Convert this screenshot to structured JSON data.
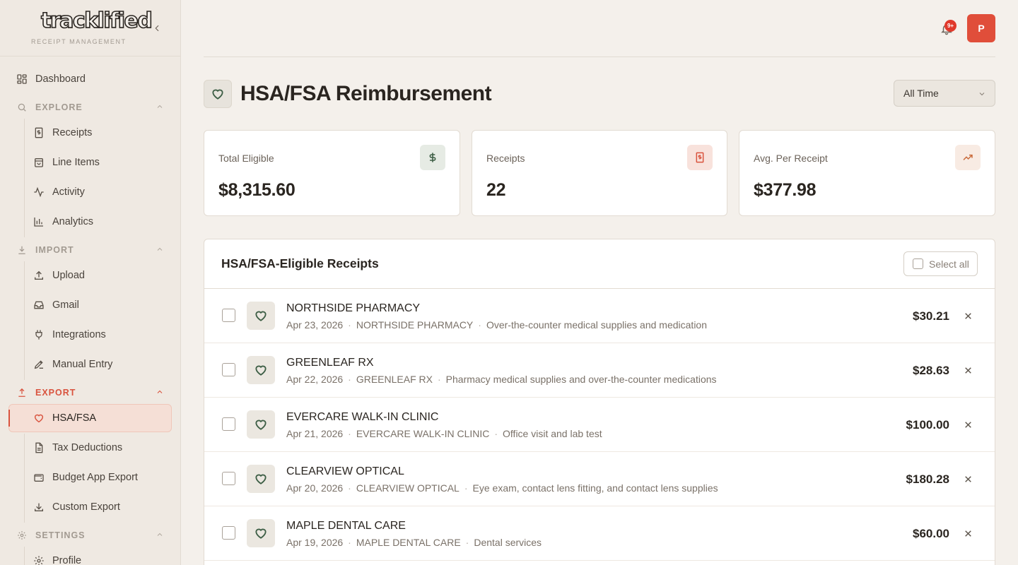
{
  "brand": {
    "logo": "tracklified",
    "tagline": "RECEIPT MANAGEMENT"
  },
  "nav": {
    "dashboard": "Dashboard",
    "explore": {
      "label": "EXPLORE",
      "items": [
        "Receipts",
        "Line Items",
        "Activity",
        "Analytics"
      ]
    },
    "import": {
      "label": "IMPORT",
      "items": [
        "Upload",
        "Gmail",
        "Integrations",
        "Manual Entry"
      ]
    },
    "export": {
      "label": "EXPORT",
      "items": [
        "HSA/FSA",
        "Tax Deductions",
        "Budget App Export",
        "Custom Export"
      ]
    },
    "settings": {
      "label": "SETTINGS",
      "items": [
        "Profile"
      ]
    },
    "active_item": "HSA/FSA"
  },
  "topbar": {
    "notification_badge": "9+",
    "avatar_initial": "P"
  },
  "header": {
    "title": "HSA/FSA Reimbursement",
    "period": "All Time"
  },
  "stats": [
    {
      "label": "Total Eligible",
      "value": "$8,315.60",
      "icon": "dollar-icon"
    },
    {
      "label": "Receipts",
      "value": "22",
      "icon": "receipt-icon"
    },
    {
      "label": "Avg. Per Receipt",
      "value": "$377.98",
      "icon": "trending-up-icon"
    }
  ],
  "list": {
    "title": "HSA/FSA-Eligible Receipts",
    "select_all": "Select all",
    "rows": [
      {
        "merchant": "NORTHSIDE PHARMACY",
        "date": "Apr 23, 2026",
        "vendor": "NORTHSIDE PHARMACY",
        "description": "Over-the-counter medical supplies and medication",
        "amount": "$30.21"
      },
      {
        "merchant": "GREENLEAF RX",
        "date": "Apr 22, 2026",
        "vendor": "GREENLEAF RX",
        "description": "Pharmacy medical supplies and over-the-counter medications",
        "amount": "$28.63"
      },
      {
        "merchant": "EVERCARE WALK-IN CLINIC",
        "date": "Apr 21, 2026",
        "vendor": "EVERCARE WALK-IN CLINIC",
        "description": "Office visit and lab test",
        "amount": "$100.00"
      },
      {
        "merchant": "CLEARVIEW OPTICAL",
        "date": "Apr 20, 2026",
        "vendor": "CLEARVIEW OPTICAL",
        "description": "Eye exam, contact lens fitting, and contact lens supplies",
        "amount": "$180.28"
      },
      {
        "merchant": "MAPLE DENTAL CARE",
        "date": "Apr 19, 2026",
        "vendor": "MAPLE DENTAL CARE",
        "description": "Dental services",
        "amount": "$60.00"
      }
    ]
  },
  "colors": {
    "accent": "#d9533e",
    "background": "#f4f0eb",
    "sidebar": "#efe9e2",
    "green_icon": "#3d5e45"
  }
}
